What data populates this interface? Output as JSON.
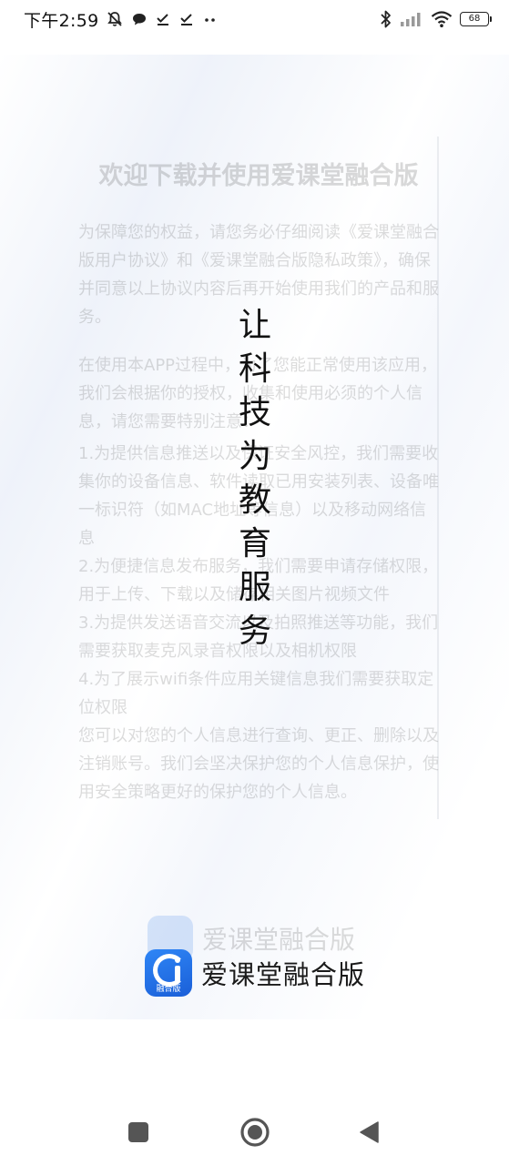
{
  "status_bar": {
    "time": "下午2:59",
    "battery_level": "68",
    "left_icons": [
      "muted-bell-icon",
      "chat-bubble-icon",
      "check-icon",
      "check-icon",
      "more-dots-icon"
    ],
    "right_icons": [
      "bluetooth-icon",
      "signal-icon",
      "wifi-icon",
      "battery-icon"
    ]
  },
  "background_doc": {
    "title": "欢迎下载并使用爱课堂融合版",
    "paragraph_1": "为保障您的权益，请您务必仔细阅读《爱课堂融合版用户协议》和《爱课堂融合版隐私政策》，确保并同意以上协议内容后再开始使用我们的产品和服务。",
    "paragraph_2": "在使用本APP过程中，为了您能正常使用该应用，我们会根据你的授权，收集和使用必须的个人信息，请您需要特别注意：",
    "items": [
      "1.为提供信息推送以及保证安全风控，我们需要收集你的设备信息、软件读取已用安装列表、设备唯一标识符（如MAC地址等信息）以及移动网络信息",
      "2.为便捷信息发布服务，我们需要申请存储权限，用于上传、下载以及储存相关图片视频文件",
      "3.为提供发送语音交流以及拍照推送等功能，我们需要获取麦克风录音权限以及相机权限",
      "4.为了展示wifi条件应用关键信息我们需要获取定位权限",
      "您可以对您的个人信息进行查询、更正、删除以及注销账号。我们会坚决保护您的个人信息保护，使用安全策略更好的保护您的个人信息。"
    ],
    "brand_name": "爱课堂融合版"
  },
  "slogan": [
    "让",
    "科",
    "技",
    "为",
    "教",
    "育",
    "服",
    "务"
  ],
  "brand": {
    "app_name": "爱课堂融合版",
    "logo_label": "融合版",
    "logo_color": "#1e6fe6"
  },
  "nav_bar": {
    "icons": [
      "recents-square-icon",
      "home-circle-icon",
      "back-triangle-icon"
    ]
  }
}
